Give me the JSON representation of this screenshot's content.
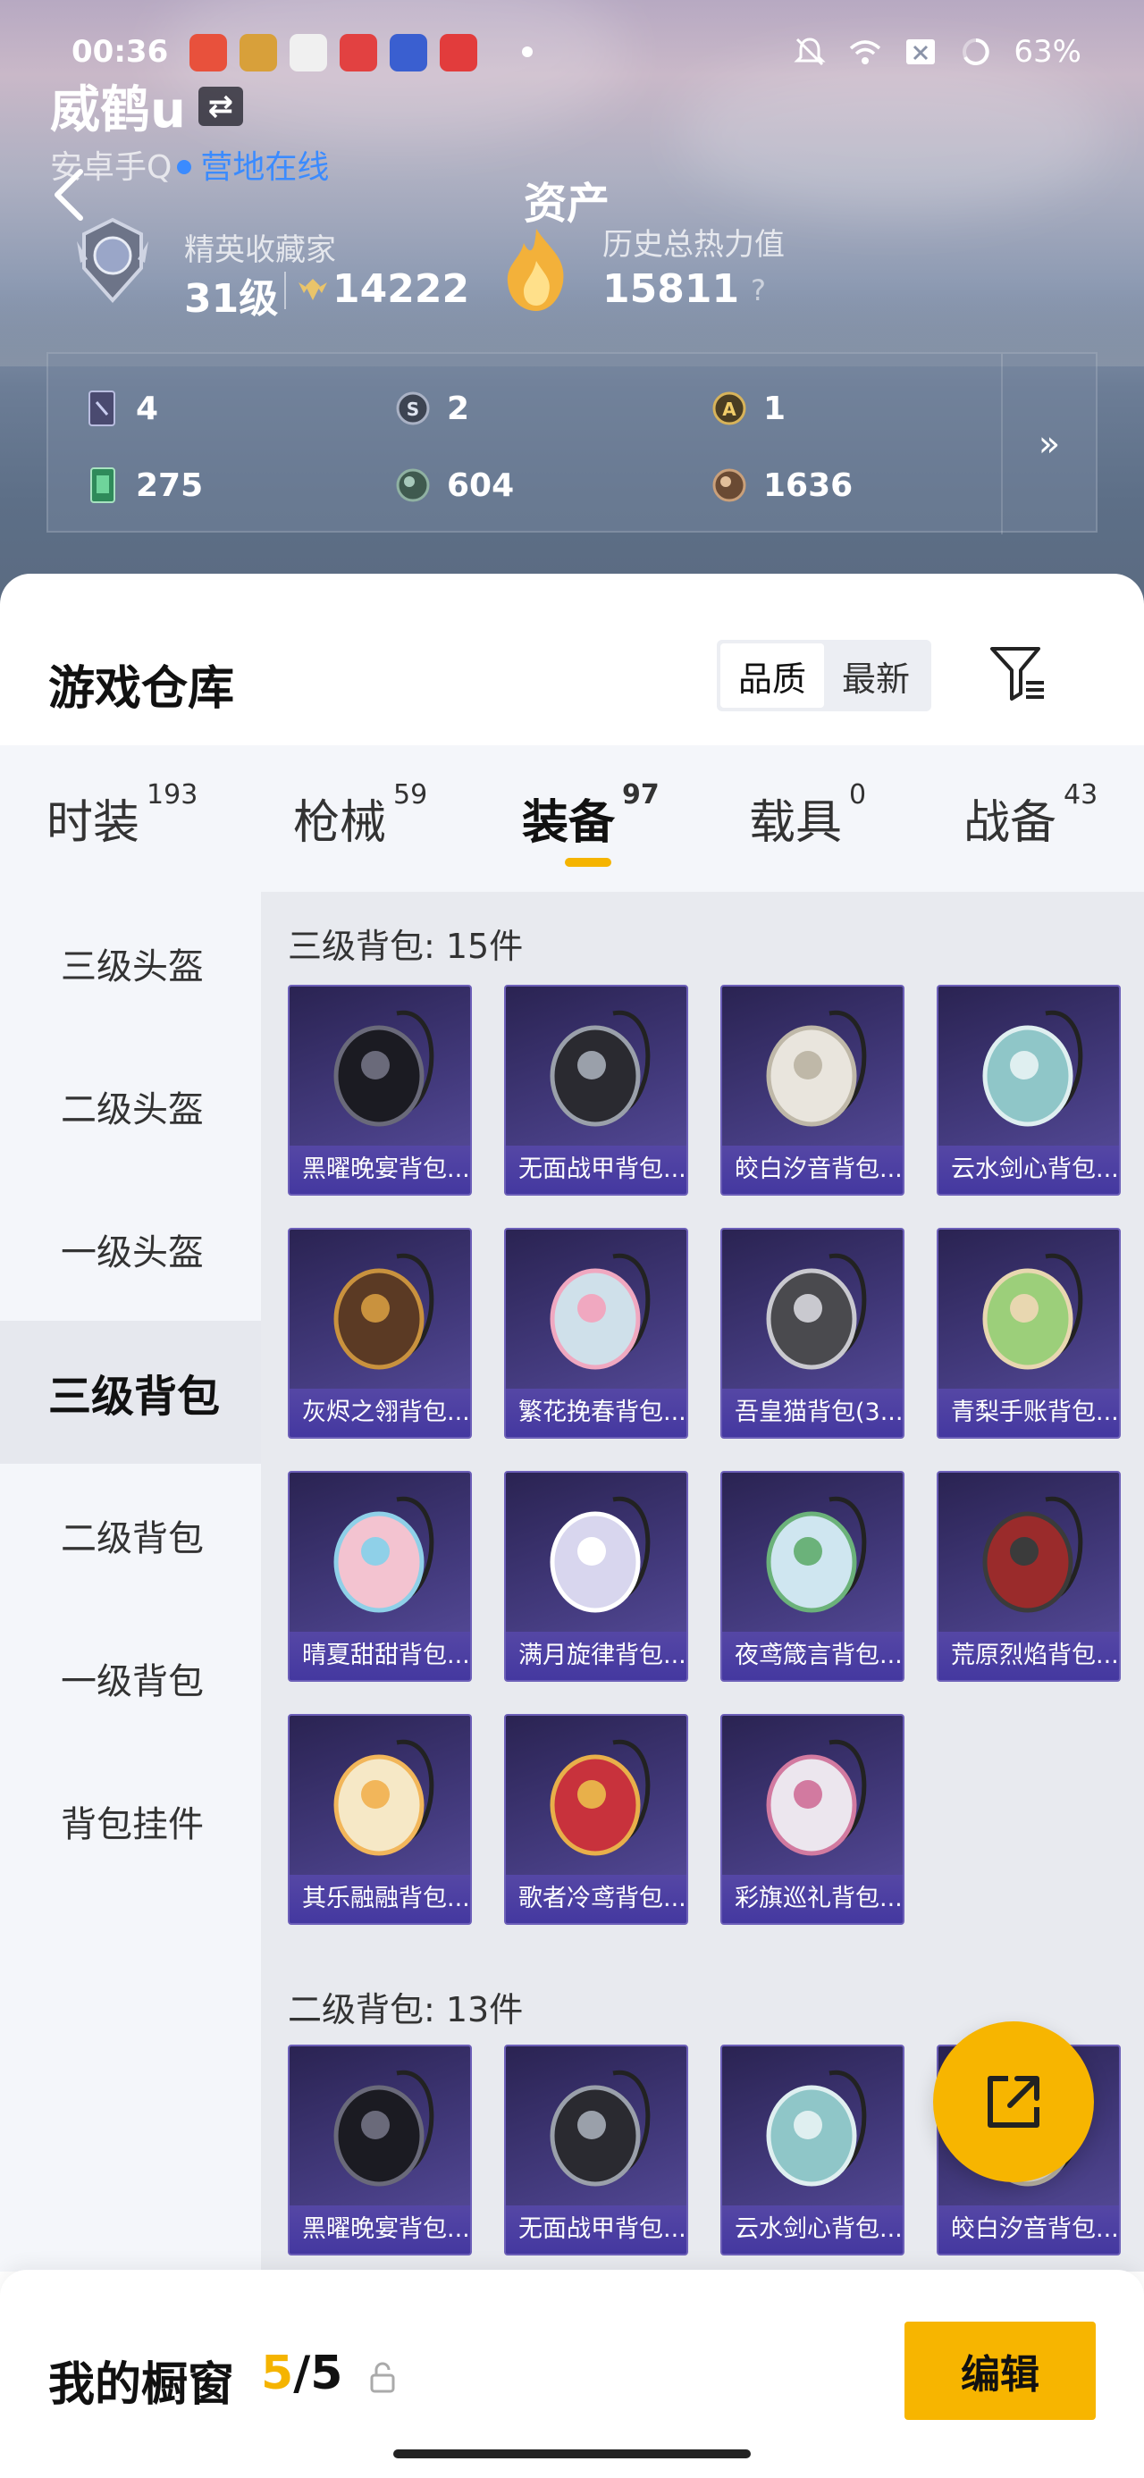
{
  "status_bar": {
    "time": "00:36",
    "battery": "63%",
    "app_icon_colors": [
      "#e8513c",
      "#d8a03a",
      "#5fb4e0",
      "#e24141",
      "#3a5fd0",
      "#e23c3c"
    ]
  },
  "profile": {
    "username": "威鹤u",
    "platform": "安卓手Q",
    "online_status": "营地在线",
    "assets_title": "资产",
    "collector_title": "精英收藏家",
    "level": "31级",
    "collector_score": "14222",
    "heat_label": "历史总热力值",
    "heat_value": "15811",
    "help_mark": "?"
  },
  "stats": [
    {
      "icon": "card-icon",
      "value": "4"
    },
    {
      "icon": "s-coin-icon",
      "value": "2"
    },
    {
      "icon": "a-coin-icon",
      "value": "1"
    },
    {
      "icon": "ticket-icon",
      "value": "275"
    },
    {
      "icon": "green-orb-icon",
      "value": "604"
    },
    {
      "icon": "bronze-orb-icon",
      "value": "1636"
    }
  ],
  "warehouse": {
    "title": "游戏仓库",
    "sort_options": [
      "品质",
      "最新"
    ],
    "active_sort": "品质"
  },
  "tabs": [
    {
      "label": "时装",
      "count": "193"
    },
    {
      "label": "枪械",
      "count": "59"
    },
    {
      "label": "装备",
      "count": "97",
      "active": true
    },
    {
      "label": "载具",
      "count": "0"
    },
    {
      "label": "战备",
      "count": "43"
    }
  ],
  "sidebar": [
    {
      "label": "三级头盔"
    },
    {
      "label": "二级头盔"
    },
    {
      "label": "一级头盔"
    },
    {
      "label": "三级背包",
      "active": true
    },
    {
      "label": "二级背包"
    },
    {
      "label": "一级背包"
    },
    {
      "label": "背包挂件"
    }
  ],
  "sections": [
    {
      "title": "三级背包: 15件",
      "items": [
        {
          "name": "黑曜晚宴背包...",
          "icon": "dog-backpack-icon"
        },
        {
          "name": "无面战甲背包...",
          "icon": "armor-backpack-icon"
        },
        {
          "name": "皎白汐音背包...",
          "icon": "pearl-backpack-icon"
        },
        {
          "name": "云水剑心背包...",
          "icon": "sword-backpack-icon"
        },
        {
          "name": "灰烬之翎背包...",
          "icon": "ember-backpack-icon"
        },
        {
          "name": "繁花挽春背包...",
          "icon": "flower-backpack-icon"
        },
        {
          "name": "吾皇猫背包(3...",
          "icon": "cat-backpack-icon"
        },
        {
          "name": "青梨手账背包...",
          "icon": "pear-backpack-icon"
        },
        {
          "name": "晴夏甜甜背包...",
          "icon": "bunny-backpack-icon"
        },
        {
          "name": "满月旋律背包...",
          "icon": "moon-backpack-icon"
        },
        {
          "name": "夜鸢箴言背包...",
          "icon": "jellyfish-backpack-icon"
        },
        {
          "name": "荒原烈焰背包...",
          "icon": "flame-backpack-icon"
        },
        {
          "name": "其乐融融背包...",
          "icon": "cupcake-backpack-icon"
        },
        {
          "name": "歌者冷鸢背包...",
          "icon": "pouch-backpack-icon"
        },
        {
          "name": "彩旗巡礼背包...",
          "icon": "kitty-backpack-icon"
        }
      ]
    },
    {
      "title": "二级背包: 13件",
      "items": [
        {
          "name": "黑曜晚宴背包...",
          "icon": "dog-backpack-icon"
        },
        {
          "name": "无面战甲背包...",
          "icon": "armor-backpack-icon"
        },
        {
          "name": "云水剑心背包...",
          "icon": "sword-backpack-icon"
        },
        {
          "name": "皎白汐音背包...",
          "icon": "pearl-backpack-icon"
        }
      ]
    }
  ],
  "showcase": {
    "label": "我的橱窗",
    "current": "5",
    "separator": "/",
    "total": "5",
    "edit_label": "编辑"
  },
  "colors": {
    "accent": "#f7b500",
    "online": "#3b8bff",
    "card_bg": "#433a7d",
    "card_label": "#4438a0"
  }
}
